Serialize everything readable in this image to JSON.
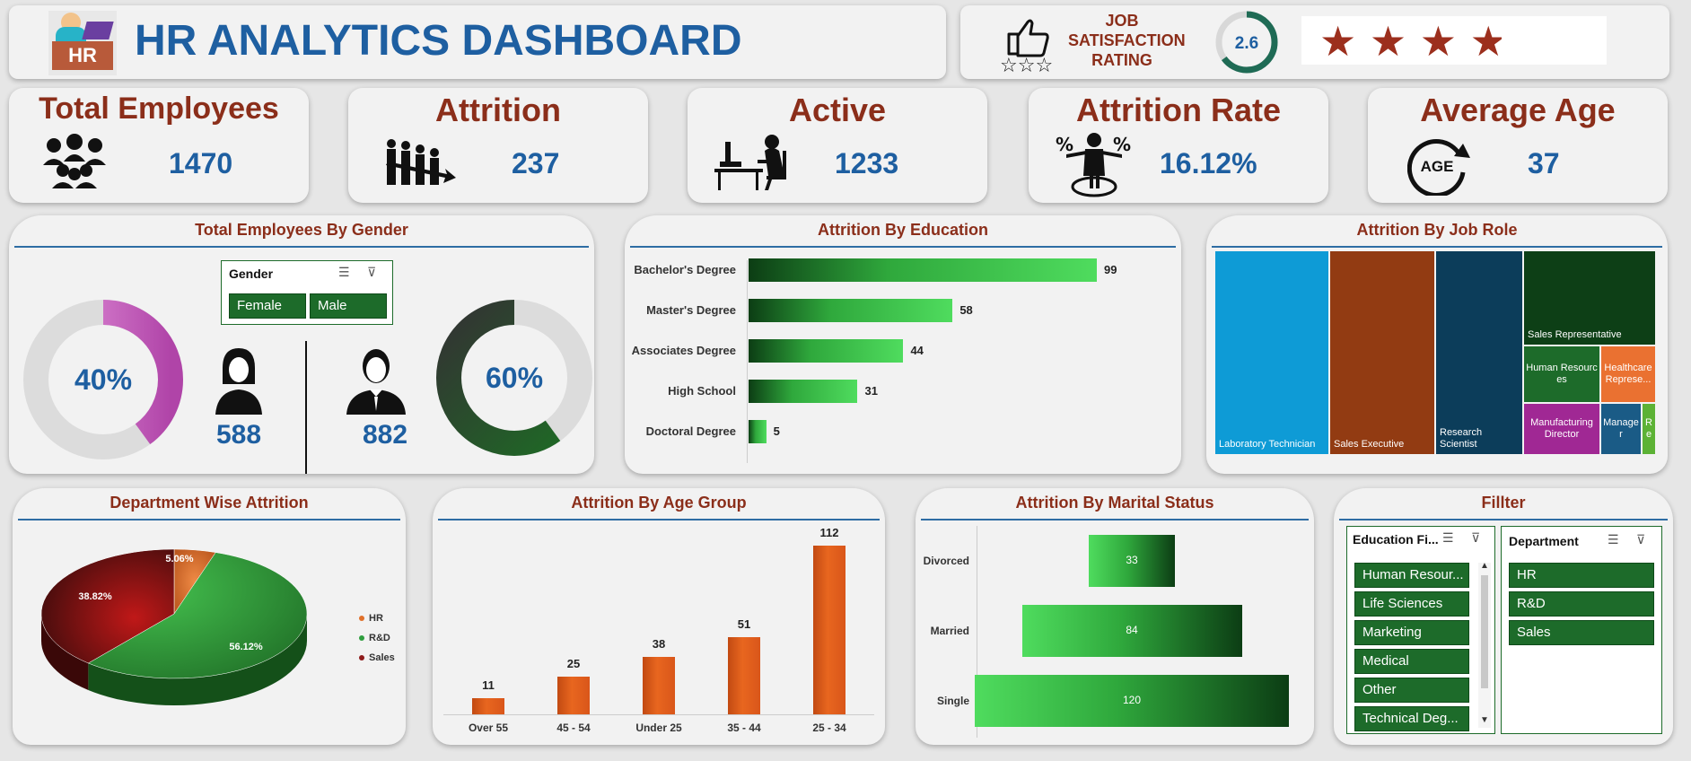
{
  "header": {
    "logo_text": "HR",
    "title": "HR ANALYTICS DASHBOARD",
    "job_sat_label_1": "JOB",
    "job_sat_label_2": "SATISFACTION",
    "job_sat_label_3": "RATING",
    "job_sat_value": "2.6",
    "job_sat_fraction": 0.65,
    "stars_rating": 2.6
  },
  "kpis": {
    "total_employees": {
      "label": "Total Employees",
      "value": "1470"
    },
    "attrition": {
      "label": "Attrition",
      "value": "237"
    },
    "active": {
      "label": "Active",
      "value": "1233"
    },
    "attrition_rate": {
      "label": "Attrition Rate",
      "value": "16.12%"
    },
    "average_age": {
      "label": "Average Age",
      "value": "37",
      "icon_text": "AGE"
    }
  },
  "gender_panel": {
    "title": "Total Employees By Gender",
    "slicer_title": "Gender",
    "slicer_options": [
      "Female",
      "Male"
    ],
    "female_pct": "40%",
    "male_pct": "60%",
    "female_count": "588",
    "male_count": "882",
    "female_fraction": 0.4,
    "male_fraction": 0.6
  },
  "education_panel": {
    "title": "Attrition By Education",
    "chart_data": {
      "type": "bar",
      "categories": [
        "Bachelor's Degree",
        "Master's Degree",
        "Associates Degree",
        "High School",
        "Doctoral Degree"
      ],
      "values": [
        99,
        58,
        44,
        31,
        5
      ]
    }
  },
  "jobrole_panel": {
    "title": "Attrition By Job Role",
    "chart_data": {
      "type": "treemap",
      "labels": [
        "Laboratory Technician",
        "Sales Executive",
        "Research Scientist",
        "Sales Representative",
        "Human Resources",
        "Healthcare Represe...",
        "Manufacturing Director",
        "Manager",
        "Re"
      ],
      "colors": [
        "#0e9bd6",
        "#923b12",
        "#0c3d5a",
        "#0d3f16",
        "#1d6b2a",
        "#ea7131",
        "#a02894",
        "#1a5b86",
        "#5cb235"
      ]
    }
  },
  "dept_panel": {
    "title": "Department Wise Attrition",
    "chart_data": {
      "type": "pie",
      "labels": [
        "HR",
        "R&D",
        "Sales"
      ],
      "values": [
        5.06,
        56.12,
        38.82
      ],
      "value_labels": [
        "5.06%",
        "56.12%",
        "38.82%"
      ],
      "colors": [
        "#e0702a",
        "#2f9e3e",
        "#8e1b1b"
      ]
    }
  },
  "age_panel": {
    "title": "Attrition By Age Group",
    "chart_data": {
      "type": "bar",
      "categories": [
        "Over 55",
        "45 - 54",
        "Under 25",
        "35 - 44",
        "25 - 34"
      ],
      "values": [
        11,
        25,
        38,
        51,
        112
      ]
    }
  },
  "marital_panel": {
    "title": "Attrition By Marital Status",
    "chart_data": {
      "type": "bar",
      "categories": [
        "Divorced",
        "Married",
        "Single"
      ],
      "values": [
        33,
        84,
        120
      ]
    }
  },
  "filter_panel": {
    "title": "Fillter",
    "education_slicer_title": "Education Fi...",
    "education_options": [
      "Human Resour...",
      "Life Sciences",
      "Marketing",
      "Medical",
      "Other",
      "Technical Deg..."
    ],
    "department_slicer_title": "Department",
    "department_options": [
      "HR",
      "R&D",
      "Sales"
    ]
  }
}
